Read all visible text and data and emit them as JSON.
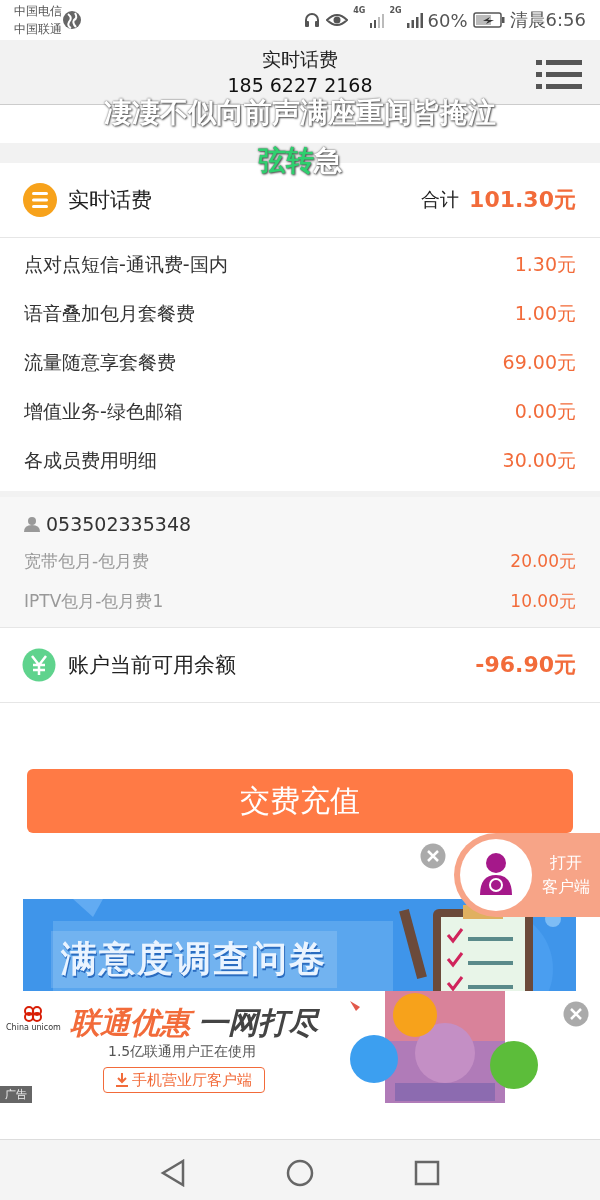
{
  "status_bar": {
    "carriers": [
      "中国电信",
      "中国联通"
    ],
    "network_1": "4G",
    "network_2": "2G",
    "battery": "60%",
    "time": "清晨6:56"
  },
  "header": {
    "title": "实时话费",
    "phone": "185 6227 2168"
  },
  "lyrics": {
    "line_1": "凄凄不似向前声满座重闻皆掩泣",
    "line_2_sung": "弦转",
    "line_2_rest": "急"
  },
  "summary": {
    "title": "实时话费",
    "total_label": "合计",
    "total": "101.30元"
  },
  "items": [
    {
      "name": "点对点短信-通讯费-国内",
      "amount": "1.30元"
    },
    {
      "name": "语音叠加包月套餐费",
      "amount": "1.00元"
    },
    {
      "name": "流量随意享套餐费",
      "amount": "69.00元"
    },
    {
      "name": "增值业务-绿色邮箱",
      "amount": "0.00元"
    },
    {
      "name": "各成员费用明细",
      "amount": "30.00元"
    }
  ],
  "member": {
    "number": "053502335348",
    "items": [
      {
        "name": "宽带包月-包月费",
        "amount": "20.00元"
      },
      {
        "name": "IPTV包月-包月费1",
        "amount": "10.00元"
      }
    ]
  },
  "balance": {
    "label": "账户当前可用余额",
    "amount": "-96.90元"
  },
  "pay_button": "交费充值",
  "float_button": {
    "line_1": "打开",
    "line_2": "客户端"
  },
  "survey_banner": {
    "title": "满意度调查问卷"
  },
  "ad": {
    "logo_text": "China unicom",
    "headline_1": "联通优惠",
    "headline_2": "一网打尽",
    "subtitle": "1.5亿联通用户正在使用",
    "button": "手机营业厅客户端",
    "tag": "广告"
  }
}
